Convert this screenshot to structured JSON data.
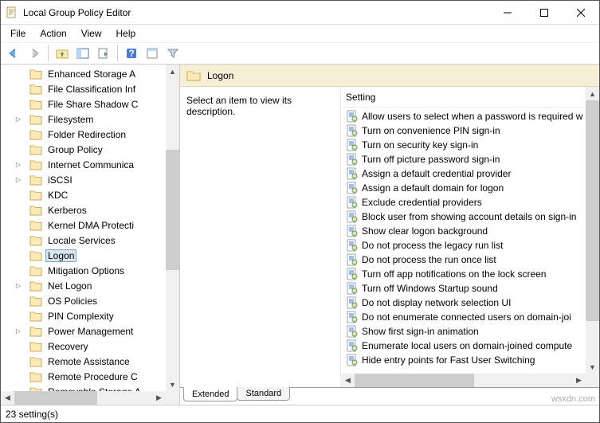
{
  "window": {
    "title": "Local Group Policy Editor"
  },
  "menu": {
    "items": [
      "File",
      "Action",
      "View",
      "Help"
    ]
  },
  "tree": {
    "items": [
      {
        "label": "Enhanced Storage A",
        "exp": false
      },
      {
        "label": "File Classification Inf",
        "exp": false
      },
      {
        "label": "File Share Shadow C",
        "exp": false
      },
      {
        "label": "Filesystem",
        "exp": true
      },
      {
        "label": "Folder Redirection",
        "exp": false
      },
      {
        "label": "Group Policy",
        "exp": false
      },
      {
        "label": "Internet Communica",
        "exp": true
      },
      {
        "label": "iSCSI",
        "exp": true
      },
      {
        "label": "KDC",
        "exp": false
      },
      {
        "label": "Kerberos",
        "exp": false
      },
      {
        "label": "Kernel DMA Protecti",
        "exp": false
      },
      {
        "label": "Locale Services",
        "exp": false
      },
      {
        "label": "Logon",
        "exp": false,
        "selected": true
      },
      {
        "label": "Mitigation Options",
        "exp": false
      },
      {
        "label": "Net Logon",
        "exp": true
      },
      {
        "label": "OS Policies",
        "exp": false
      },
      {
        "label": "PIN Complexity",
        "exp": false
      },
      {
        "label": "Power Management",
        "exp": true
      },
      {
        "label": "Recovery",
        "exp": false
      },
      {
        "label": "Remote Assistance",
        "exp": false
      },
      {
        "label": "Remote Procedure C",
        "exp": false
      },
      {
        "label": "Removable Storage A",
        "exp": false
      }
    ]
  },
  "detail": {
    "heading": "Logon",
    "description": "Select an item to view its description.",
    "column_header": "Setting",
    "settings": [
      "Allow users to select when a password is required w",
      "Turn on convenience PIN sign-in",
      "Turn on security key sign-in",
      "Turn off picture password sign-in",
      "Assign a default credential provider",
      "Assign a default domain for logon",
      "Exclude credential providers",
      "Block user from showing account details on sign-in",
      "Show clear logon background",
      "Do not process the legacy run list",
      "Do not process the run once list",
      "Turn off app notifications on the lock screen",
      "Turn off Windows Startup sound",
      "Do not display network selection UI",
      "Do not enumerate connected users on domain-joi",
      "Show first sign-in animation",
      "Enumerate local users on domain-joined compute",
      "Hide entry points for Fast User Switching"
    ]
  },
  "tabs": {
    "extended": "Extended",
    "standard": "Standard"
  },
  "status": {
    "text": "23 setting(s)"
  },
  "watermark": "wsxdn.com"
}
